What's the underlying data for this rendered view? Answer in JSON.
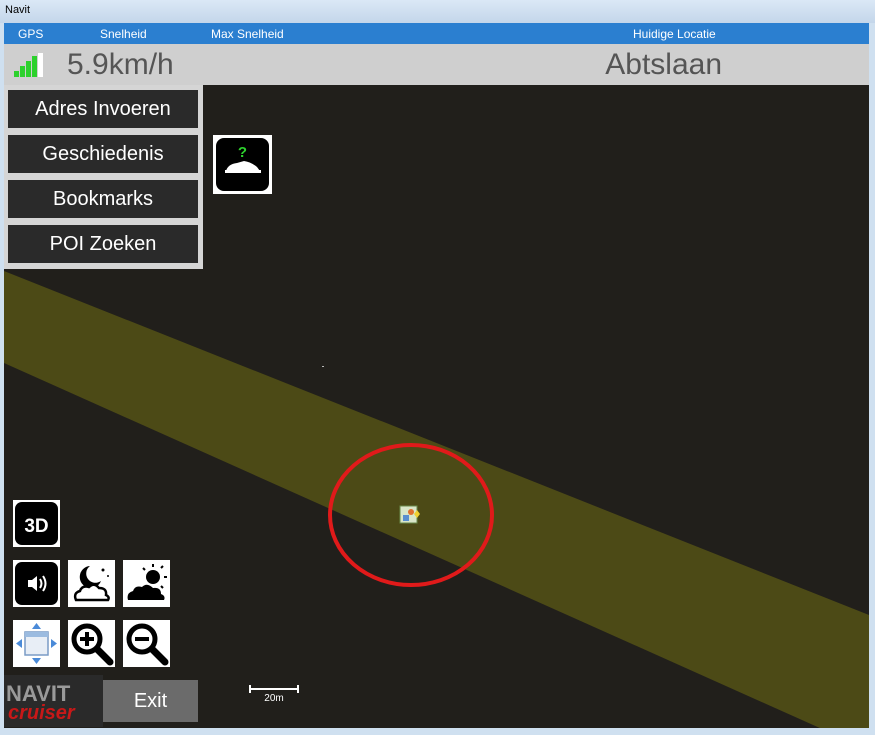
{
  "window": {
    "title": "Navit"
  },
  "header": {
    "gps_label": "GPS",
    "speed_label": "Snelheid",
    "max_speed_label": "Max Snelheid",
    "location_label": "Huidige Locatie",
    "speed_value": "5.9km/h",
    "location_value": "Abtslaan"
  },
  "menu": {
    "items": [
      "Adres Invoeren",
      "Geschiedenis",
      "Bookmarks",
      "POI Zoeken"
    ]
  },
  "controls": {
    "view_3d_label": "3D",
    "exit_label": "Exit"
  },
  "logo": {
    "line1": "NAVIT",
    "line2": "cruiser"
  },
  "scale": {
    "label": "20m"
  },
  "colors": {
    "map_background": "#211f1b",
    "road": "#4c4a16",
    "header_bar": "#2b7fd0",
    "gps_signal": "#2dd12d",
    "highlight_circle": "#e01a1a"
  }
}
